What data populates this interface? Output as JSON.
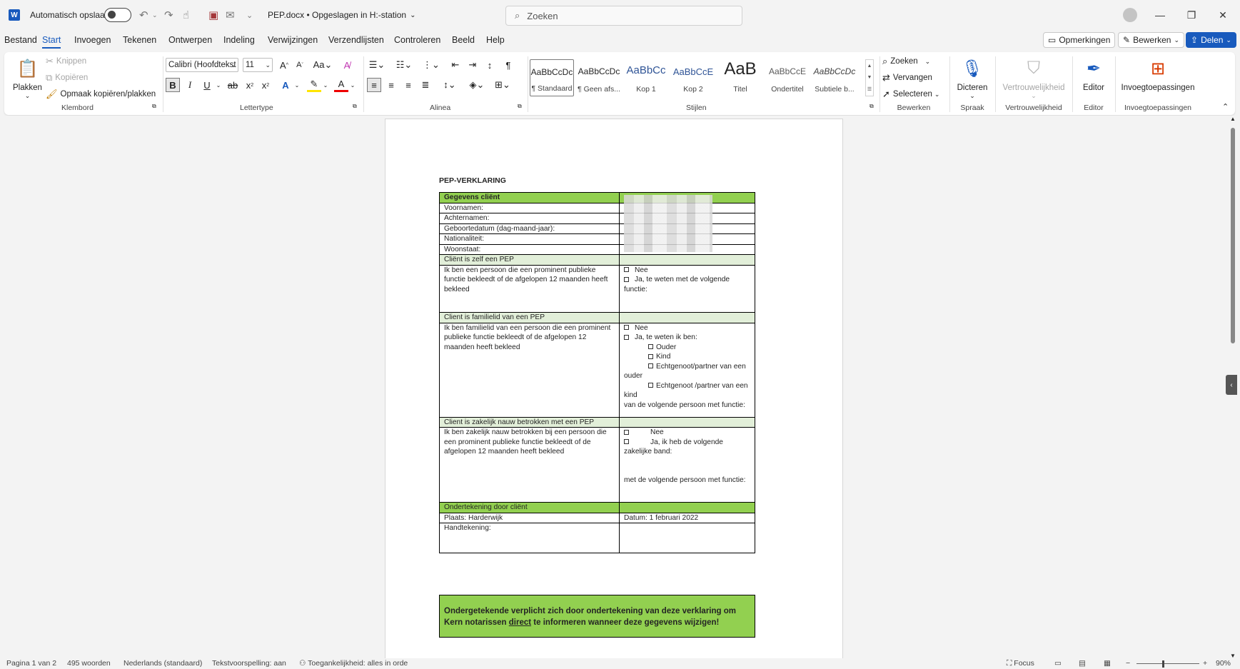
{
  "titlebar": {
    "autosave_label": "Automatisch opslaan",
    "doc_title": "PEP.docx • Opgeslagen in H:-station",
    "search_placeholder": "Zoeken",
    "minimize": "—",
    "restore": "❐",
    "close": "✕"
  },
  "menu": {
    "tabs": [
      "Bestand",
      "Start",
      "Invoegen",
      "Tekenen",
      "Ontwerpen",
      "Indeling",
      "Verwijzingen",
      "Verzendlijsten",
      "Controleren",
      "Beeld",
      "Help"
    ],
    "active": "Start",
    "opmerkingen": "Opmerkingen",
    "bewerken": "Bewerken",
    "delen": "Delen"
  },
  "ribbon": {
    "klembord": {
      "label": "Klembord",
      "plakken": "Plakken",
      "knippen": "Knippen",
      "kopieren": "Kopiëren",
      "opmaak": "Opmaak kopiëren/plakken"
    },
    "lettertype": {
      "label": "Lettertype",
      "font": "Calibri (Hoofdtekst",
      "size": "11"
    },
    "alinea": {
      "label": "Alinea"
    },
    "stijlen": {
      "label": "Stijlen",
      "items": [
        {
          "sample": "AaBbCcDc",
          "name": "¶ Standaard"
        },
        {
          "sample": "AaBbCcDc",
          "name": "¶ Geen afs..."
        },
        {
          "sample": "AaBbCc",
          "name": "Kop 1"
        },
        {
          "sample": "AaBbCcE",
          "name": "Kop 2"
        },
        {
          "sample": "AaB",
          "name": "Titel"
        },
        {
          "sample": "AaBbCcE",
          "name": "Ondertitel"
        },
        {
          "sample": "AaBbCcDc",
          "name": "Subtiele b..."
        }
      ]
    },
    "bewerken": {
      "label": "Bewerken",
      "zoeken": "Zoeken",
      "vervangen": "Vervangen",
      "selecteren": "Selecteren"
    },
    "spraak": {
      "label": "Spraak",
      "dicteren": "Dicteren"
    },
    "vertrouwelijkheid": {
      "label": "Vertrouwelijkheid",
      "btn": "Vertrouwelijkheid"
    },
    "editor": {
      "label": "Editor",
      "btn": "Editor"
    },
    "invoeg": {
      "label": "Invoegtoepassingen",
      "btn": "Invoegtoepassingen"
    }
  },
  "document": {
    "heading": "PEP-VERKLARING",
    "gegevens_header": "Gegevens cliënt",
    "fields": {
      "voornamen": "Voornamen:",
      "achternamen": "Achternamen:",
      "geboortedatum": "Geboortedatum (dag-maand-jaar):",
      "nationaliteit": "Nationaliteit:",
      "woonstaat": "Woonstaat:"
    },
    "sec1_header": "Cliënt is zelf een PEP",
    "sec1_text": "Ik ben een persoon die een prominent publieke functie bekleedt of de afgelopen 12 maanden heeft bekleed",
    "sec1_nee": "Nee",
    "sec1_ja": "Ja, te weten met de volgende functie:",
    "sec2_header": "Client is familielid van een PEP",
    "sec2_text": "Ik ben familielid van een persoon die een prominent publieke functie bekleedt of de afgelopen 12 maanden heeft bekleed",
    "sec2_nee": "Nee",
    "sec2_ja": "Ja, te weten ik ben:",
    "sec2_opts": [
      "Ouder",
      "Kind",
      "Echtgenoot/partner van een ouder",
      "Echtgenoot /partner van een kind"
    ],
    "sec2_footer": "van de volgende persoon met functie:",
    "sec3_header": "Client is zakelijk nauw betrokken met een PEP",
    "sec3_text": "Ik ben zakelijk nauw betrokken bij een persoon die een prominent publieke functie bekleedt of de afgelopen 12 maanden heeft bekleed",
    "sec3_nee": "Nee",
    "sec3_ja": "Ja, ik heb de volgende zakelijke band:",
    "sec3_footer": "met de volgende persoon met functie:",
    "sig_header": "Ondertekening door cliënt",
    "plaats": "Plaats: Harderwijk",
    "datum": "Datum: 1 februari 2022",
    "handtekening": "Handtekening:",
    "notice_a": "Ondergetekende verplicht zich door ondertekening van deze verklaring om Kern notarissen ",
    "notice_u": "direct",
    "notice_b": " te informeren wanneer deze gegevens wijzigen!"
  },
  "statusbar": {
    "page": "Pagina 1 van 2",
    "words": "495 woorden",
    "language": "Nederlands (standaard)",
    "spelling": "Tekstvoorspelling: aan",
    "accessibility": "Toegankelijkheid: alles in orde",
    "focus": "Focus",
    "zoom": "90%"
  },
  "colors": {
    "accent": "#185abd",
    "green_header": "#92d050",
    "light_header": "#e2efd9"
  }
}
